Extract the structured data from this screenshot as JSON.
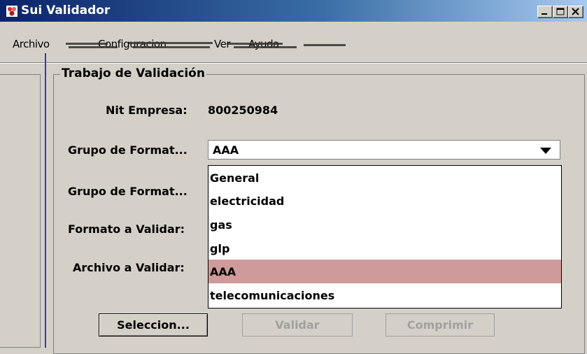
{
  "window": {
    "title": "Sui Validador"
  },
  "menu": {
    "items": [
      "Archivo",
      "Configuracion",
      "Ver",
      "Ayuda"
    ]
  },
  "group": {
    "title": "Trabajo de Validación",
    "nit_label": "Nit Empresa:",
    "nit_value": "800250984",
    "grupo_label_1": "Grupo de Format...",
    "grupo_label_2": "Grupo de Format...",
    "formato_label": "Formato a Validar:",
    "archivo_label": "Archivo a Validar:"
  },
  "combo": {
    "selected": "AAA",
    "options": [
      "General",
      "electricidad",
      "gas",
      "glp",
      "AAA",
      "telecomunicaciones"
    ],
    "selected_index": 4
  },
  "buttons": {
    "seleccion": "Seleccion...",
    "validar": "Validar",
    "comprimir": "Comprimir"
  },
  "colors": {
    "title_start": "#0a246a",
    "title_end": "#a6caf0",
    "selected_option": "#cf9a9a",
    "splitter": "#2b3ec8"
  }
}
